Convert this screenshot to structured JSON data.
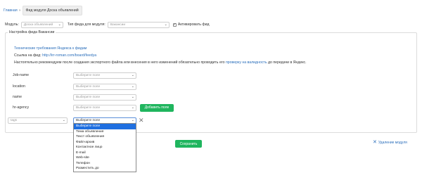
{
  "breadcrumb": {
    "home": "Главная",
    "separator": "»",
    "current": "Фид модуля Доска объявлений"
  },
  "top": {
    "module_label": "Модуль:",
    "module_value": "Доска объявлений",
    "feed_type_label": "Тип фида для модуля:",
    "feed_type_value": "Вакансии",
    "activate_label": "Активировать фид",
    "activate_checked": "✓"
  },
  "settings": {
    "legend": "Настройка фида Вакансии",
    "req_link": "Технические требования Яндекса к фидам",
    "feed_link_label": "Ссылка на фид:",
    "feed_url": "http://irr-roman.com/board/feedya",
    "notice_before": "Настоятельно рекомендуем после создания экспортного файла или внесения в него изменений обязательно проводить его",
    "notice_link": "проверку на валидность",
    "notice_after": "до передачи в Яндекс."
  },
  "fields": [
    {
      "label": "Job-name",
      "value": "Выберите поле"
    },
    {
      "label": "location",
      "value": "Выберите поле"
    },
    {
      "label": "name",
      "value": "Выберите поле"
    },
    {
      "label": "hr-agency",
      "value": "Выберите поле"
    }
  ],
  "add_field_button": "Добавить поле",
  "custom_row": {
    "tag_placeholder": "tags",
    "value": "Выберите поле",
    "remove": "✕"
  },
  "dropdown_options": [
    "Выберите поле",
    "Тема объявления",
    "Текст объявления",
    "Файл-архив",
    "Контактное лицо",
    "E-mail",
    "Web-site",
    "Телефон",
    "Разместить до"
  ],
  "save_button": "Сохранить",
  "delete_module": {
    "icon": "close-icon",
    "label": "Удаление модуля"
  },
  "chevron": "⌄",
  "colors": {
    "link": "#2a6ebb",
    "green": "#1fb55e",
    "highlight": "#1f6fe0"
  }
}
